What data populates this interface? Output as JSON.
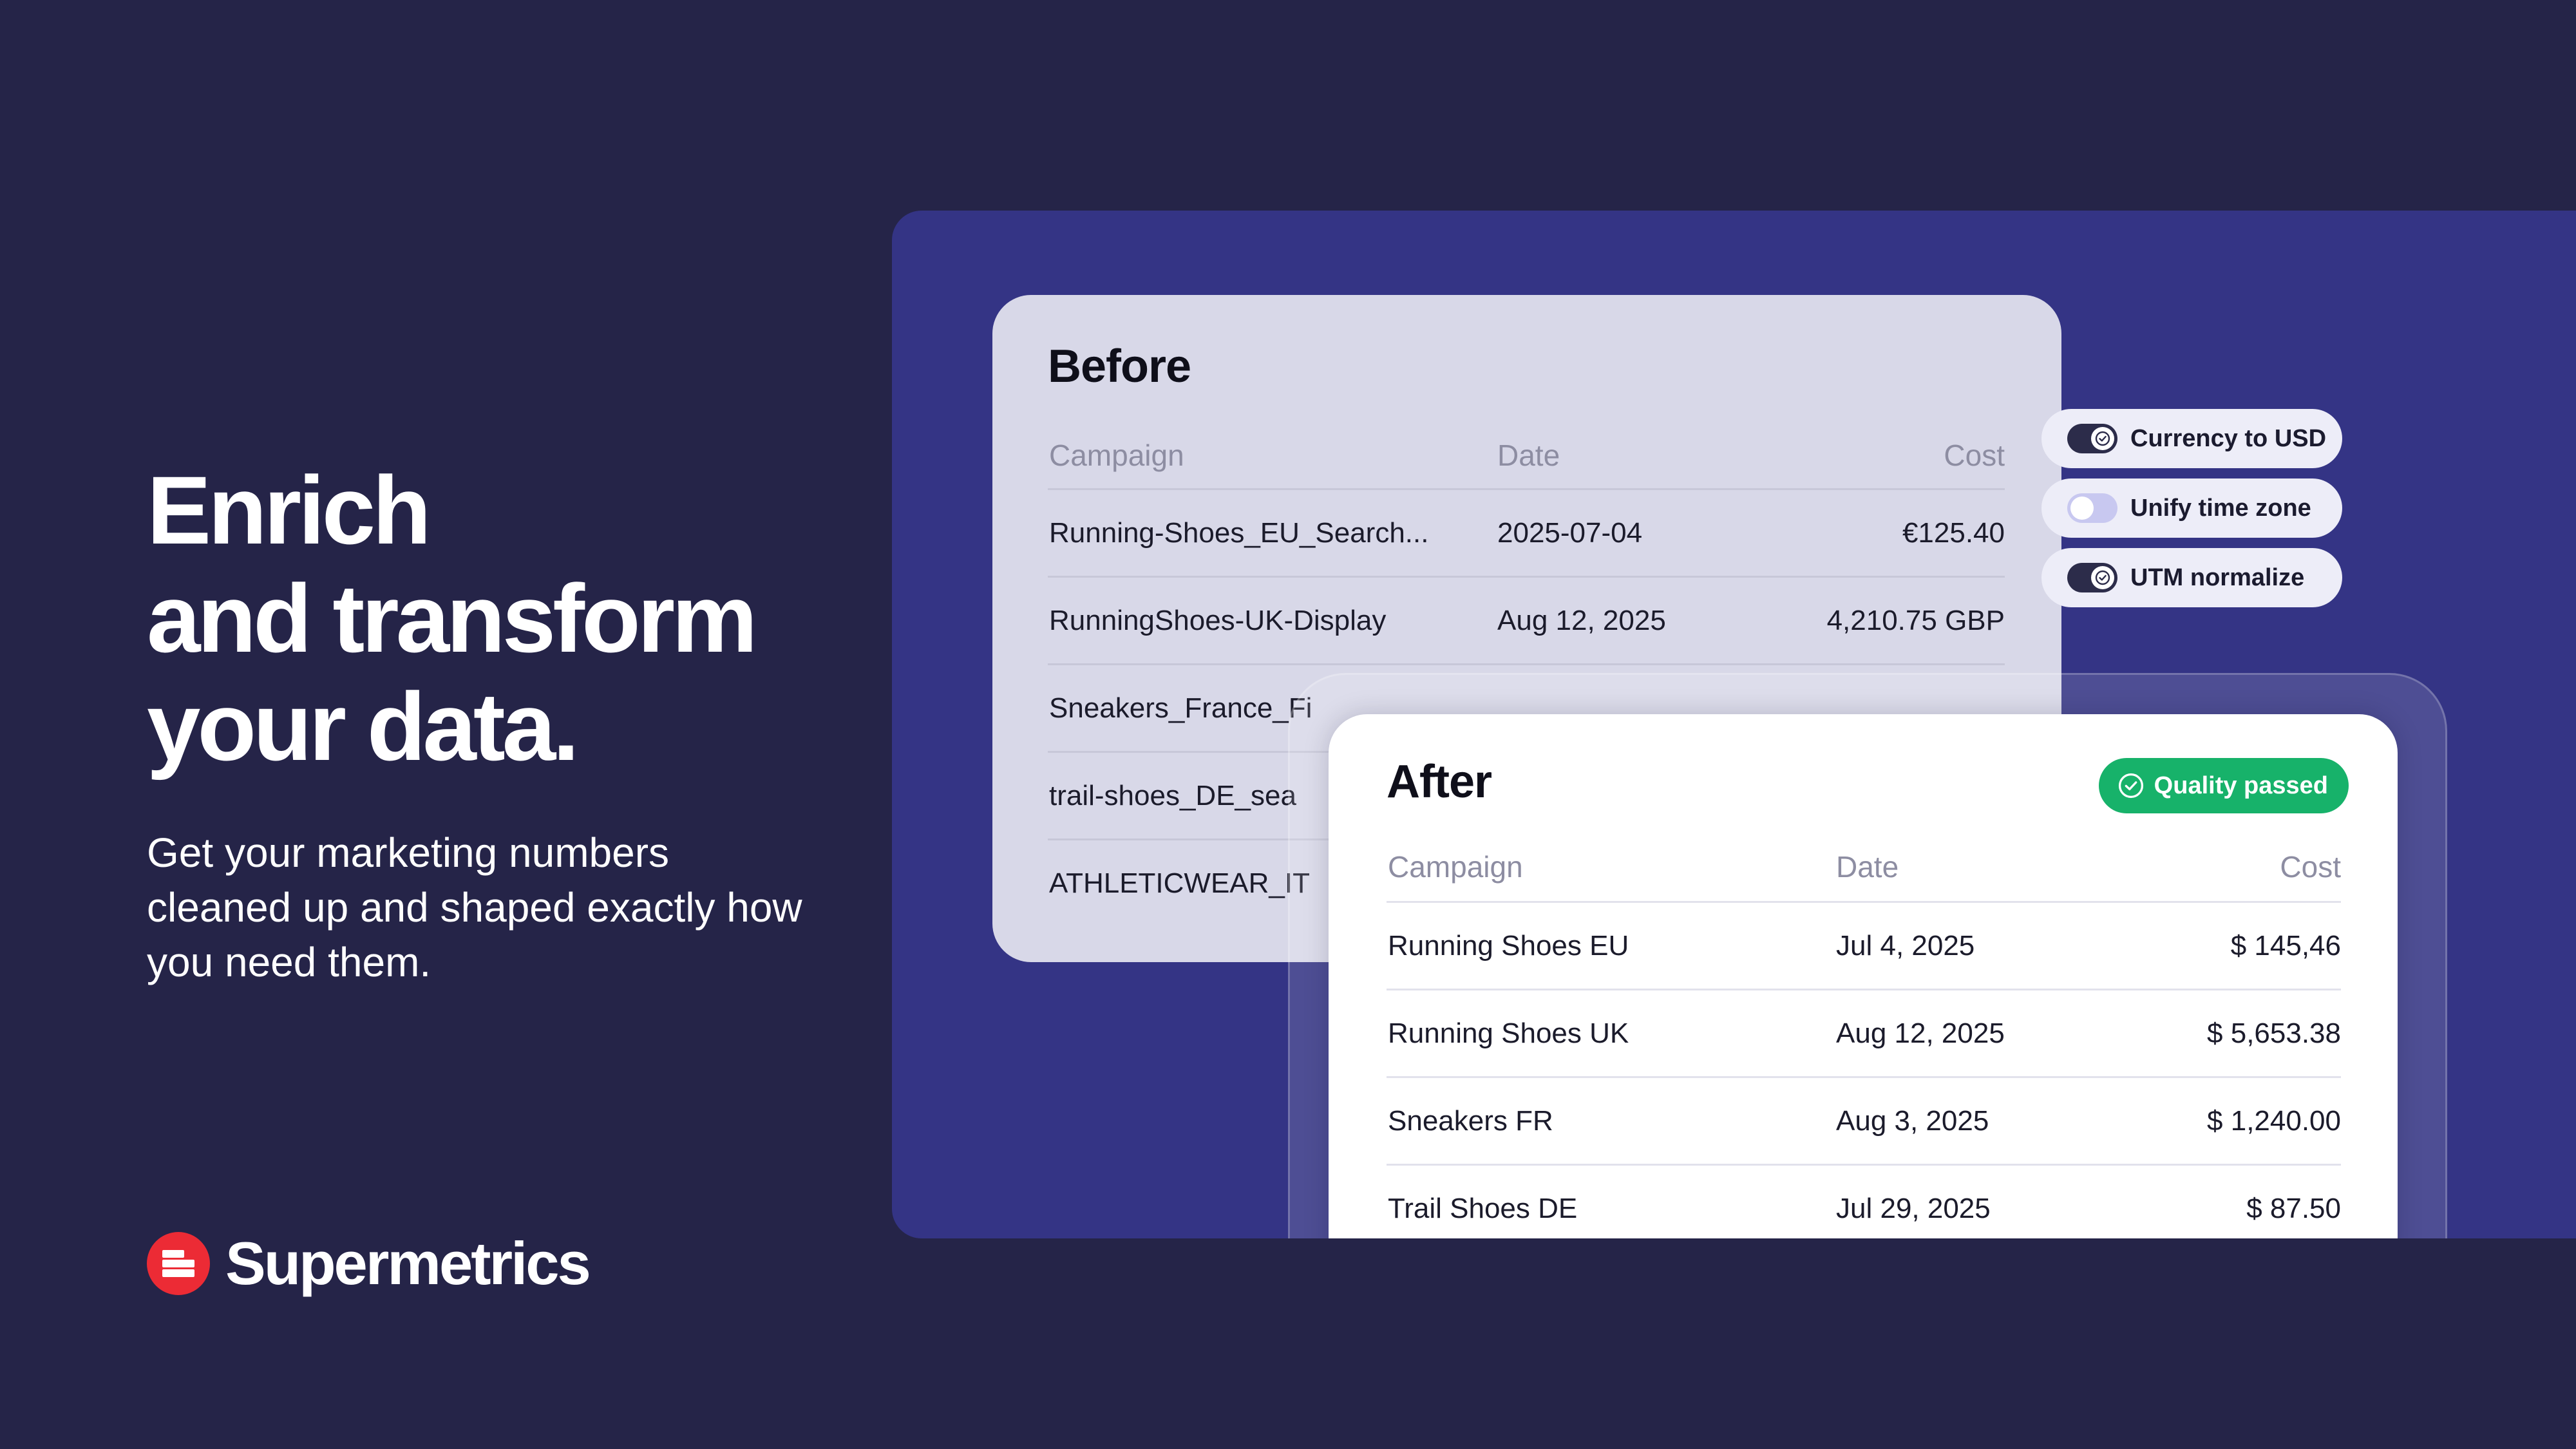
{
  "headline": {
    "line1": "Enrich",
    "line2": "and transform",
    "line3": "your data."
  },
  "subtext": "Get your marketing numbers cleaned up and shaped exactly how you need them.",
  "brand": {
    "name": "Supermetrics",
    "color": "#ec2b35"
  },
  "colors": {
    "background": "#252448",
    "panel": "#343485",
    "success": "#17b26a"
  },
  "before": {
    "title": "Before",
    "columns": {
      "campaign": "Campaign",
      "date": "Date",
      "cost": "Cost"
    },
    "rows": [
      {
        "campaign": "Running-Shoes_EU_Search...",
        "date": "2025-07-04",
        "cost": "€125.40"
      },
      {
        "campaign": "RunningShoes-UK-Display",
        "date": "Aug 12, 2025",
        "cost": "4,210.75 GBP"
      },
      {
        "campaign": "Sneakers_France_Fi",
        "date": "",
        "cost": ""
      },
      {
        "campaign": "trail-shoes_DE_sea",
        "date": "",
        "cost": ""
      },
      {
        "campaign": "ATHLETICWEAR_IT",
        "date": "",
        "cost": ""
      }
    ]
  },
  "toggles": [
    {
      "label": "Currency to USD",
      "on": true
    },
    {
      "label": "Unify time zone",
      "on": false
    },
    {
      "label": "UTM normalize",
      "on": true
    }
  ],
  "after": {
    "title": "After",
    "badge": {
      "label": "Quality passed",
      "icon": "check-circle-icon"
    },
    "columns": {
      "campaign": "Campaign",
      "date": "Date",
      "cost": "Cost"
    },
    "rows": [
      {
        "campaign": "Running Shoes EU",
        "date": "Jul 4, 2025",
        "cost": "$ 145,46"
      },
      {
        "campaign": "Running Shoes UK",
        "date": "Aug 12, 2025",
        "cost": "$ 5,653.38"
      },
      {
        "campaign": "Sneakers FR",
        "date": "Aug 3, 2025",
        "cost": "$ 1,240.00"
      },
      {
        "campaign": "Trail Shoes DE",
        "date": "Jul 29, 2025",
        "cost": "$ 87.50"
      }
    ]
  }
}
